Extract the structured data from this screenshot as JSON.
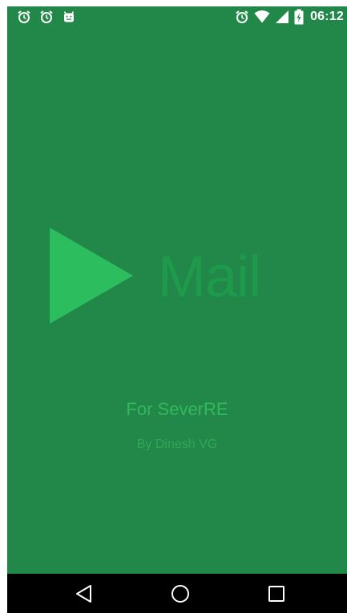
{
  "status_bar": {
    "left_icons": [
      "alarm-icon",
      "alarm-icon",
      "android-debug-icon"
    ],
    "right_icons": [
      "alarm-icon",
      "wifi-icon",
      "cellular-signal-icon",
      "battery-charging-icon"
    ],
    "time": "06:12"
  },
  "splash": {
    "logo_icon": "play-triangle-icon",
    "logo_text": "Mail",
    "subtitle": "For SeverRE",
    "author": "By Dinesh VG"
  },
  "colors": {
    "background": "#22884a",
    "play_triangle": "#2cbd5e",
    "logo_text": "#1e9a4b",
    "subtitle": "#33b85c",
    "author": "#2fa855",
    "nav_bar": "#000000"
  },
  "nav_bar": {
    "buttons": [
      "back-icon",
      "home-icon",
      "recents-icon"
    ]
  }
}
